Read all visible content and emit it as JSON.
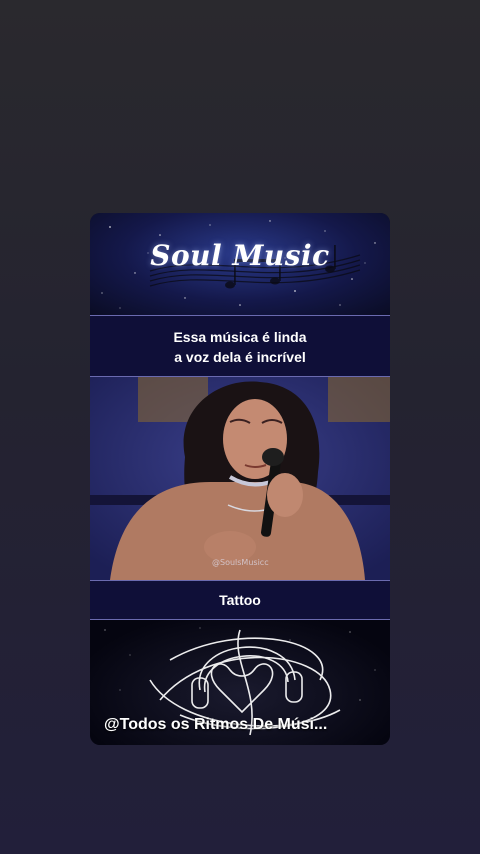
{
  "brand": {
    "title": "Soul Music"
  },
  "caption": {
    "line1": "Essa música é linda",
    "line2": "a voz dela é incrível"
  },
  "video": {
    "watermark": "@SoulsMusicc"
  },
  "song": {
    "title": "Tattoo"
  },
  "footer": {
    "credit": "@Todos os Ritmos De Músi..."
  },
  "colors": {
    "panel": "#0f0f38",
    "border": "#6a6ab0",
    "accent": "#2a3a8a"
  },
  "icons": {
    "music-notes": "music-notes-icon",
    "headphones-heart": "headphones-heart-icon"
  }
}
